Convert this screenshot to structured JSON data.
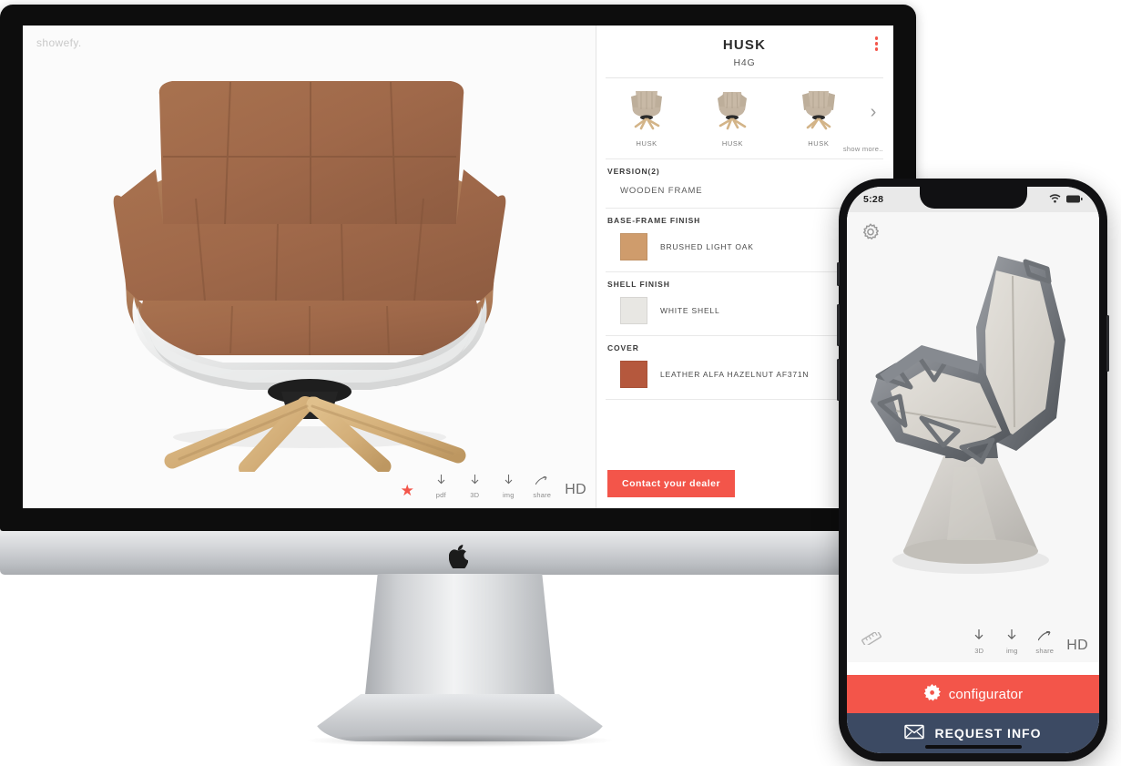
{
  "desktop": {
    "viewer": {
      "brand": "showefy.",
      "product_image_alt": "HUSK armchair brown leather white shell wooden frame",
      "tools": [
        {
          "icon": "star-icon",
          "caption": ""
        },
        {
          "icon": "download-icon",
          "caption": "pdf"
        },
        {
          "icon": "download-icon",
          "caption": "3D"
        },
        {
          "icon": "download-icon",
          "caption": "img"
        },
        {
          "icon": "share-icon",
          "caption": "share"
        }
      ],
      "quality_label": "HD"
    },
    "config": {
      "title": "HUSK",
      "subtitle": "H4G",
      "menu_icon": "kebab-menu-icon",
      "thumbnails": [
        {
          "label": "HUSK"
        },
        {
          "label": "HUSK"
        },
        {
          "label": "HUSK"
        }
      ],
      "next_icon": "chevron-right-icon",
      "show_more": "show more..",
      "groups": [
        {
          "heading": "VERSION(2)",
          "value": "WOODEN FRAME",
          "swatch": null,
          "chevron": true
        },
        {
          "heading": "BASE-FRAME FINISH",
          "value": "BRUSHED LIGHT OAK",
          "swatch": "#cf9c6c",
          "chevron": false
        },
        {
          "heading": "SHELL FINISH",
          "value": "WHITE SHELL",
          "swatch": "#e8e7e3",
          "chevron": false
        },
        {
          "heading": "COVER",
          "value": "LEATHER ALFA HAZELNUT AF371N",
          "swatch": "#b5583d",
          "chevron": false
        }
      ],
      "dealer_button": "Contact your dealer"
    }
  },
  "phone": {
    "status": {
      "time": "5:28",
      "wifi_icon": "wifi-icon",
      "battery_icon": "battery-icon"
    },
    "settings_icon": "gear-icon",
    "measure_icon": "ruler-icon",
    "product_image_alt": "Geometric metal frame chair with concrete conical base",
    "tools": [
      {
        "icon": "download-icon",
        "caption": "3D"
      },
      {
        "icon": "download-icon",
        "caption": "img"
      },
      {
        "icon": "share-icon",
        "caption": "share"
      }
    ],
    "quality_label": "HD",
    "configurator_button": {
      "label": "configurator",
      "icon": "gear-burst-icon",
      "color": "#f3554a"
    },
    "request_info_button": {
      "label": "REQUEST INFO",
      "icon": "envelope-icon",
      "color": "#3c4a63"
    }
  },
  "colors": {
    "accent_red": "#f3554a",
    "navy": "#3c4a63"
  }
}
